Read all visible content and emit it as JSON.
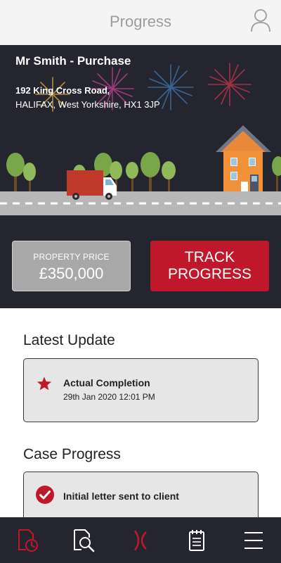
{
  "header": {
    "title": "Progress",
    "profile_icon": "user-icon"
  },
  "case": {
    "title": "Mr Smith - Purchase",
    "address_line1": "192 King Cross Road,",
    "address_line2": "HALIFAX, West Yorkshire, HX1 3JP"
  },
  "price": {
    "label": "PROPERTY PRICE",
    "value": "£350,000"
  },
  "track_button": {
    "line1": "TRACK",
    "line2": "PROGRESS"
  },
  "latest_update": {
    "heading": "Latest Update",
    "event": "Actual Completion",
    "timestamp": "29th Jan 2020 12:01 PM",
    "icon": "star-icon"
  },
  "case_progress": {
    "heading": "Case Progress",
    "steps": [
      {
        "label": "Initial letter sent to client",
        "status_icon": "check-circle-icon"
      }
    ]
  },
  "nav": {
    "items": [
      {
        "icon": "clock-document-icon",
        "active": true
      },
      {
        "icon": "document-search-icon",
        "active": false
      },
      {
        "icon": "brand-logo-icon",
        "active": false
      },
      {
        "icon": "notepad-icon",
        "active": false
      },
      {
        "icon": "menu-icon",
        "active": false
      }
    ]
  },
  "colors": {
    "accent": "#c0182b",
    "dark": "#25252f",
    "card_bg": "#e6e6e6",
    "price_bg": "#a8a8a8",
    "header_text": "#9c9c9c"
  }
}
